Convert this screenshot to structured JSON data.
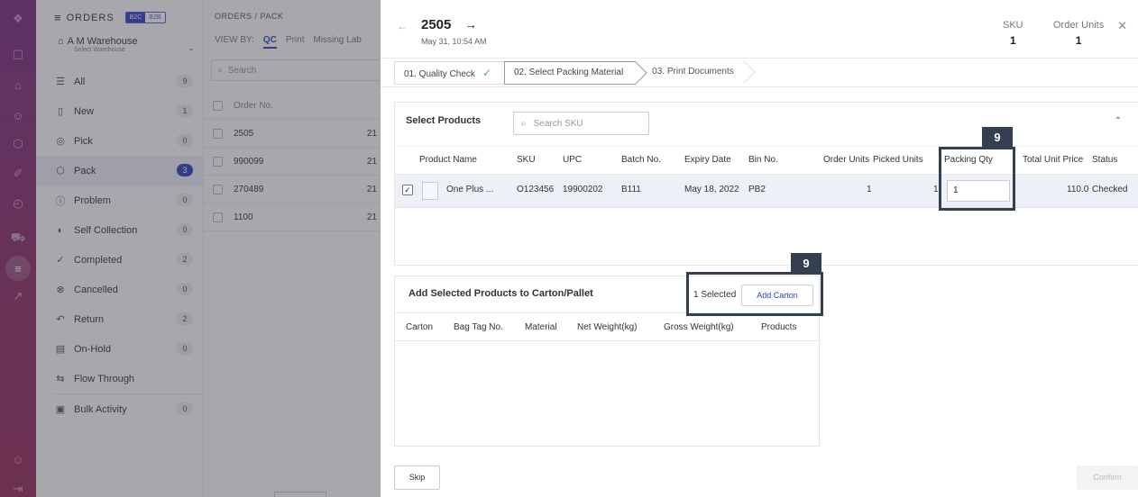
{
  "rail": {
    "icons": [
      "logo-icon",
      "dashboard-icon",
      "home-icon",
      "users-icon",
      "box-icon",
      "tag-icon",
      "clock-icon",
      "truck-icon",
      "layers-icon",
      "share-icon",
      "profile-icon",
      "logout-icon"
    ]
  },
  "sidebar": {
    "title": "ORDERS",
    "seg_b2c": "B2C",
    "seg_b2b": "B2B",
    "warehouse_name": "A M Warehouse",
    "warehouse_sub": "Select Warehouse",
    "items": [
      {
        "label": "All",
        "count": "9"
      },
      {
        "label": "New",
        "count": "1"
      },
      {
        "label": "Pick",
        "count": "0"
      },
      {
        "label": "Pack",
        "count": "3"
      },
      {
        "label": "Problem",
        "count": "0"
      },
      {
        "label": "Self Collection",
        "count": "0"
      },
      {
        "label": "Completed",
        "count": "2"
      },
      {
        "label": "Cancelled",
        "count": "0"
      },
      {
        "label": "Return",
        "count": "2"
      },
      {
        "label": "On-Hold",
        "count": "0"
      },
      {
        "label": "Flow Through",
        "count": ""
      },
      {
        "label": "Bulk Activity",
        "count": "0"
      }
    ]
  },
  "orders": {
    "breadcrumb": "ORDERS / PACK",
    "view_by_label": "VIEW BY:",
    "views": [
      "QC",
      "Print",
      "Missing Lab"
    ],
    "search_placeholder": "Search",
    "header": "Order No.",
    "rows": [
      {
        "no": "2505",
        "d": "21"
      },
      {
        "no": "990099",
        "d": "21"
      },
      {
        "no": "270489",
        "d": "21"
      },
      {
        "no": "1100",
        "d": "21"
      }
    ]
  },
  "drawer": {
    "order_no": "2505",
    "date": "May 31, 10:54 AM",
    "sku_label": "SKU",
    "sku_value": "1",
    "order_units_label": "Order Units",
    "order_units_value": "1",
    "steps": [
      "01. Quality Check",
      "02. Select Packing Material",
      "03. Print Documents"
    ],
    "select_products_title": "Select Products",
    "sku_search_placeholder": "Search SKU",
    "columns": [
      "Product Name",
      "SKU",
      "UPC",
      "Batch No.",
      "Expiry Date",
      "Bin No.",
      "Order Units",
      "Picked Units",
      "Packing Qty",
      "Total Unit Price",
      "Status"
    ],
    "product": {
      "name": "One Plus ...",
      "sku": "O123456",
      "upc": "19900202",
      "batch": "B111",
      "expiry": "May 18, 2022",
      "bin": "PB2",
      "order_units": "1",
      "picked_units": "1",
      "packing_qty": "1",
      "price": "110.0",
      "status": "Checked"
    },
    "carton_title": "Add Selected Products to Carton/Pallet",
    "selected_count": "1 Selected",
    "add_carton": "Add Carton",
    "carton_columns": [
      "Carton",
      "Bag Tag No.",
      "Material",
      "Net Weight(kg)",
      "Gross Weight(kg)",
      "Products"
    ],
    "skip": "Skip",
    "confirm": "Confirm"
  },
  "highlights": {
    "tag1": "9",
    "tag2": "9"
  }
}
